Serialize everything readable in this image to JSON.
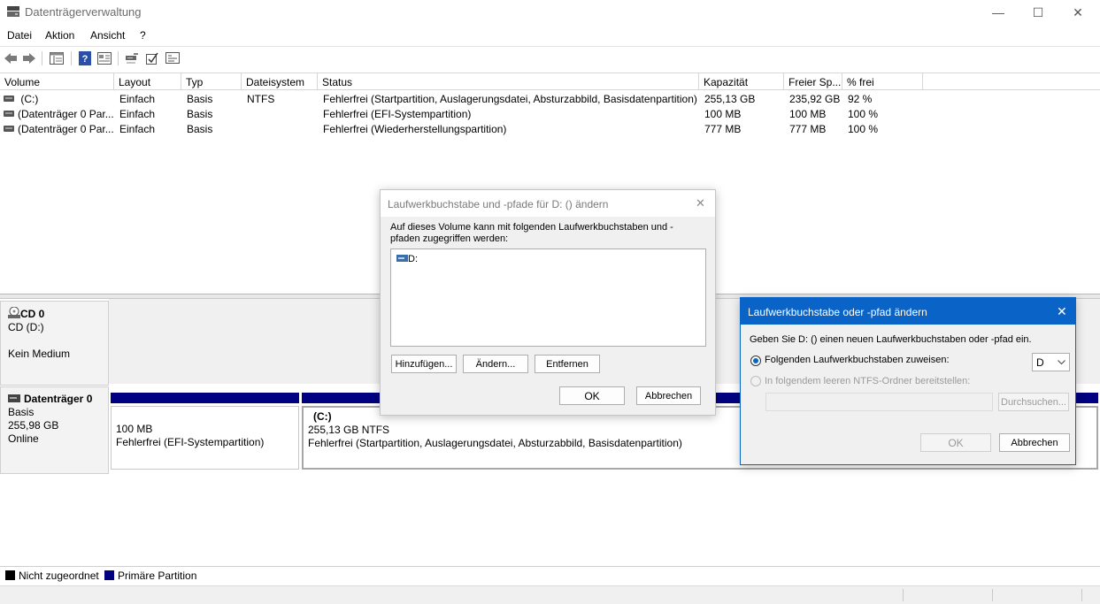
{
  "window": {
    "title": "Datenträgerverwaltung",
    "minimize": "—",
    "maximize": "☐",
    "close": "✕"
  },
  "menu": [
    "Datei",
    "Aktion",
    "Ansicht",
    "?"
  ],
  "toolbar_icons": [
    "back-arrow-icon",
    "forward-arrow-icon",
    "properties-icon",
    "help-icon",
    "view-icon",
    "connect-icon",
    "check-icon",
    "list-icon"
  ],
  "columns": [
    "Volume",
    "Layout",
    "Typ",
    "Dateisystem",
    "Status",
    "Kapazität",
    "Freier Sp...",
    "% frei"
  ],
  "volumes": [
    {
      "volume": "(C:)",
      "layout": "Einfach",
      "typ": "Basis",
      "fs": "NTFS",
      "status": "Fehlerfrei (Startpartition, Auslagerungsdatei, Absturzabbild, Basisdatenpartition)",
      "capacity": "255,13 GB",
      "free": "235,92 GB",
      "pct": "92 %"
    },
    {
      "volume": "(Datenträger 0 Par...",
      "layout": "Einfach",
      "typ": "Basis",
      "fs": "",
      "status": "Fehlerfrei (EFI-Systempartition)",
      "capacity": "100 MB",
      "free": "100 MB",
      "pct": "100 %"
    },
    {
      "volume": "(Datenträger 0 Par...",
      "layout": "Einfach",
      "typ": "Basis",
      "fs": "",
      "status": "Fehlerfrei (Wiederherstellungspartition)",
      "capacity": "777 MB",
      "free": "777 MB",
      "pct": "100 %"
    }
  ],
  "disks": {
    "cd": {
      "name": "CD 0",
      "line1": "CD (D:)",
      "line2": "Kein Medium"
    },
    "disk0": {
      "name": "Datenträger 0",
      "line1": "Basis",
      "line2": "255,98 GB",
      "line3": "Online",
      "part_efi": {
        "size": "100 MB",
        "status": "Fehlerfrei (EFI-Systempartition)"
      },
      "part_c": {
        "name": "(C:)",
        "size": "255,13 GB NTFS",
        "status": "Fehlerfrei (Startpartition, Auslagerungsdatei, Absturzabbild, Basisdatenpartition)"
      }
    }
  },
  "legend": {
    "unallocated": "Nicht zugeordnet",
    "primary": "Primäre Partition",
    "unallocated_color": "#000000",
    "primary_color": "#000080"
  },
  "dialog1": {
    "title": "Laufwerkbuchstabe und -pfade für D: () ändern",
    "description": "Auf dieses Volume kann mit folgenden Laufwerkbuchstaben und -pfaden zugegriffen werden:",
    "list_item": "D:",
    "add": "Hinzufügen...",
    "change": "Ändern...",
    "remove": "Entfernen",
    "ok": "OK",
    "cancel": "Abbrechen",
    "close": "✕"
  },
  "dialog2": {
    "title": "Laufwerkbuchstabe oder -pfad ändern",
    "prompt": "Geben Sie D: () einen neuen Laufwerkbuchstaben oder -pfad ein.",
    "option_letter": "Folgenden Laufwerkbuchstaben zuweisen:",
    "letter_value": "D",
    "option_folder": "In folgendem leeren NTFS-Ordner bereitstellen:",
    "browse": "Durchsuchen...",
    "ok": "OK",
    "cancel": "Abbrechen",
    "close": "✕",
    "accent": "#0a64c8"
  }
}
